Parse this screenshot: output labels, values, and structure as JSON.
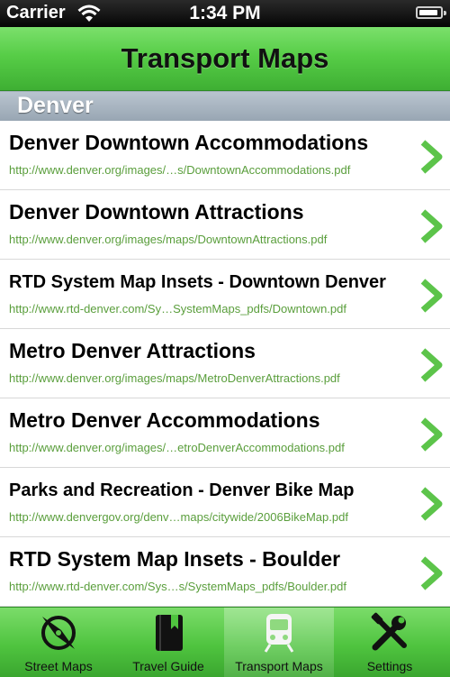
{
  "status_bar": {
    "carrier": "Carrier",
    "time": "1:34 PM",
    "battery_level": 0.9
  },
  "nav": {
    "title": "Transport Maps"
  },
  "section": {
    "title": "Denver"
  },
  "items": [
    {
      "title": "Denver Downtown Accommodations",
      "url": "http://www.denver.org/images/…s/DowntownAccommodations.pdf"
    },
    {
      "title": "Denver Downtown Attractions",
      "url": "http://www.denver.org/images/maps/DowntownAttractions.pdf"
    },
    {
      "title": "RTD System Map Insets - Downtown Denver",
      "url": "http://www.rtd-denver.com/Sy…SystemMaps_pdfs/Downtown.pdf"
    },
    {
      "title": "Metro Denver Attractions",
      "url": "http://www.denver.org/images/maps/MetroDenverAttractions.pdf"
    },
    {
      "title": "Metro Denver Accommodations",
      "url": "http://www.denver.org/images/…etroDenverAccommodations.pdf"
    },
    {
      "title": "Parks and Recreation - Denver Bike Map",
      "url": "http://www.denvergov.org/denv…maps/citywide/2006BikeMap.pdf"
    },
    {
      "title": "RTD System Map Insets - Boulder",
      "url": "http://www.rtd-denver.com/Sys…s/SystemMaps_pdfs/Boulder.pdf"
    }
  ],
  "tabs": [
    {
      "label": "Street Maps",
      "icon": "compass-icon"
    },
    {
      "label": "Travel Guide",
      "icon": "book-icon"
    },
    {
      "label": "Transport Maps",
      "icon": "train-icon"
    },
    {
      "label": "Settings",
      "icon": "tools-icon"
    }
  ],
  "selected_tab": 2,
  "colors": {
    "nav_green": "#57cd47",
    "url_green": "#5a9e3c",
    "chevron_green": "#5cc44a",
    "section_gray": "#a8b4c0"
  }
}
